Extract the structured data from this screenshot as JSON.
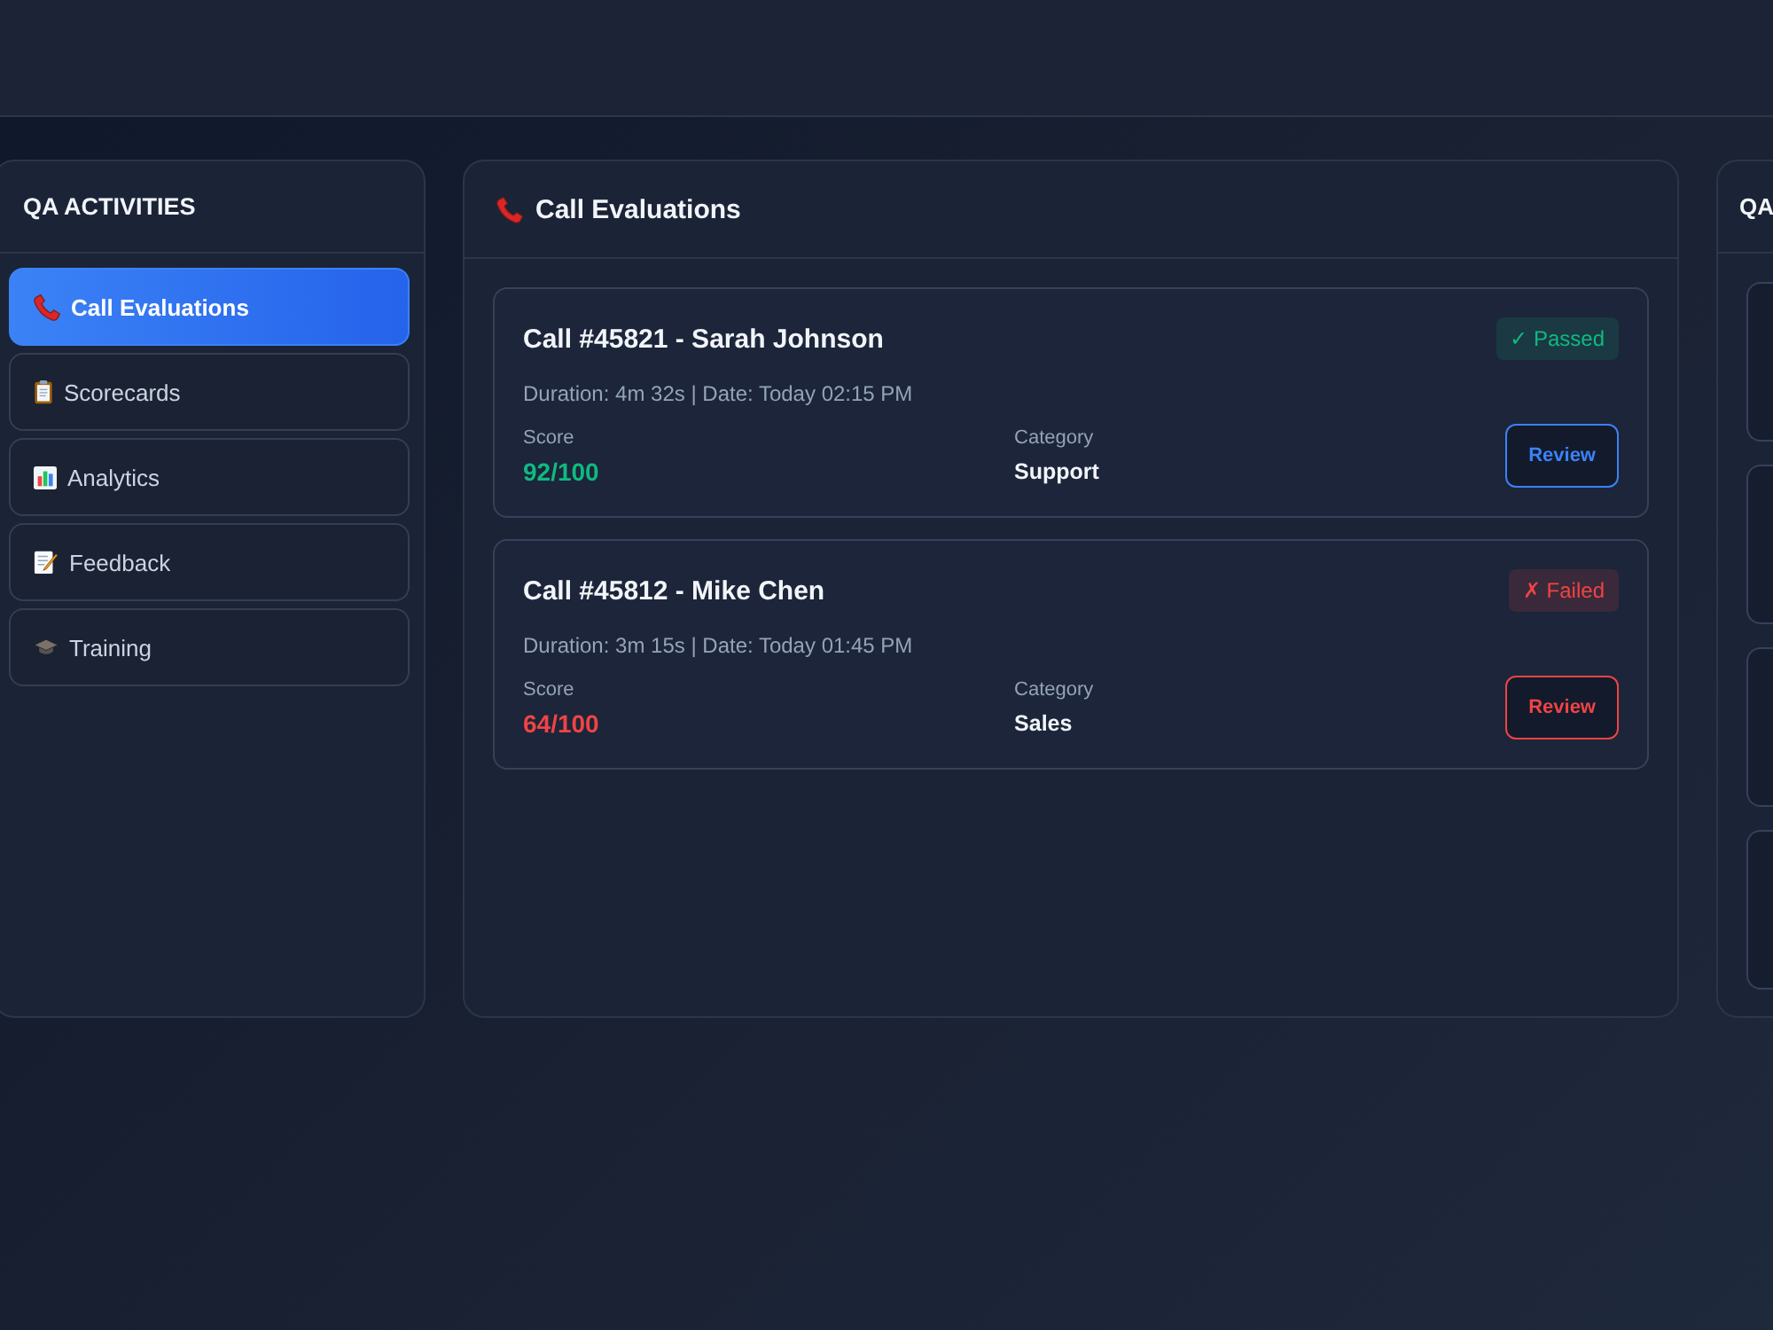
{
  "sidebar": {
    "title": "QA ACTIVITIES",
    "items": [
      {
        "label": "Call Evaluations",
        "selected": true
      },
      {
        "label": "Scorecards",
        "selected": false
      },
      {
        "label": "Analytics",
        "selected": false
      },
      {
        "label": "Feedback",
        "selected": false
      },
      {
        "label": "Training",
        "selected": false
      }
    ]
  },
  "evaluations": {
    "title": "Call Evaluations",
    "items": [
      {
        "kind": "passed",
        "title": "Call #45821 - Sarah Johnson",
        "badge": "✓ Passed",
        "meta": "Duration: 4m 32s | Date: Today 02:15 PM",
        "score_label": "Score",
        "score": "92/100",
        "category_label": "Category",
        "category": "Support",
        "action": "Review"
      },
      {
        "kind": "failed",
        "title": "Call #45812 - Mike Chen",
        "badge": "✗ Failed",
        "meta": "Duration: 3m 15s | Date: Today 01:45 PM",
        "score_label": "Score",
        "score": "64/100",
        "category_label": "Category",
        "category": "Sales",
        "action": "Review"
      }
    ]
  },
  "stats_panel": {
    "title": "QA"
  }
}
